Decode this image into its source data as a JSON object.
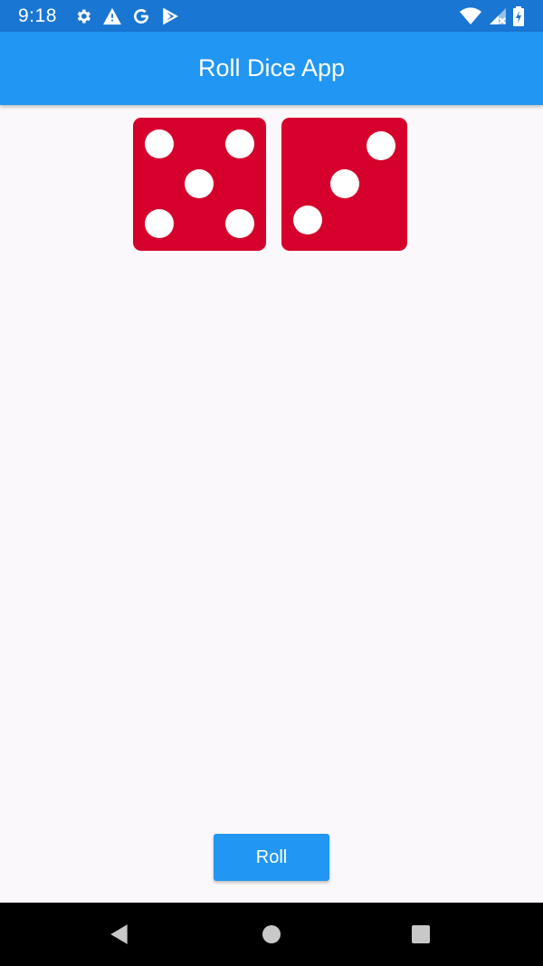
{
  "status_bar": {
    "time": "9:18",
    "left_icons": [
      "gear-icon",
      "warning-icon",
      "google-icon",
      "play-store-icon"
    ],
    "right_icons": [
      "wifi-icon",
      "cell-signal-icon",
      "battery-icon"
    ]
  },
  "app_bar": {
    "title": "Roll Dice App",
    "color": "#2196f3"
  },
  "dice": [
    {
      "value": 5,
      "color": "#d6002c"
    },
    {
      "value": 3,
      "color": "#d6002c"
    }
  ],
  "roll_button": {
    "label": "Roll",
    "color": "#2196f3"
  },
  "nav_bar": {
    "buttons": [
      "back-icon",
      "home-icon",
      "recents-icon"
    ]
  }
}
